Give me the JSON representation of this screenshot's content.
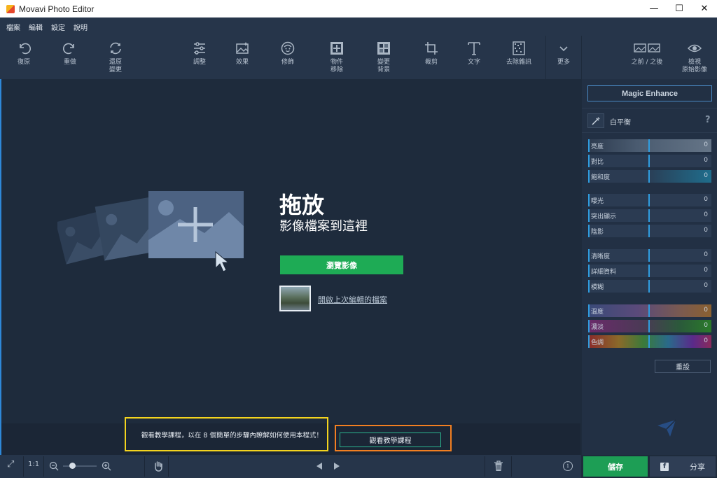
{
  "window": {
    "title": "Movavi Photo Editor",
    "minimize": "—",
    "maximize": "☐",
    "close": "✕"
  },
  "menu": [
    "檔案",
    "編輯",
    "設定",
    "說明"
  ],
  "toolbar": {
    "undo": "復原",
    "redo": "重做",
    "restore": "還原\n變更",
    "adjust": "調整",
    "effects": "效果",
    "retouch": "修飾",
    "object_removal": "物件\n移除",
    "change_bg": "變更\n背景",
    "crop": "裁剪",
    "text": "文字",
    "denoise": "去除雜訊",
    "more": "更多",
    "before_after": "之前 / 之後",
    "view_original": "檢視\n原始影像"
  },
  "canvas": {
    "drop_title": "拖放",
    "drop_subtitle": "影像檔案到這裡",
    "browse_button": "瀏覽影像",
    "recent_link": "開啟上次編輯的檔案",
    "tutorial_text": "觀看教學課程，以在 8 個簡單的步驟內瞭解如何使用本程式！",
    "tutorial_button": "觀看教學課程"
  },
  "statusbar": {
    "fit": "⤢",
    "actual_size": "1:1",
    "zoom_level": 0.3,
    "info": "i"
  },
  "panel": {
    "magic_enhance": "Magic Enhance",
    "white_balance": "白平衡",
    "help": "?",
    "sliders": [
      {
        "label": "亮度",
        "value": "0",
        "bar_value": 0
      },
      {
        "label": "對比",
        "value": "0",
        "bar_value": 0
      },
      {
        "label": "飽和度",
        "value": "0",
        "bar_value": 0
      },
      {
        "label": "曝光",
        "value": "0",
        "bar_value": 0
      },
      {
        "label": "突出顯示",
        "value": "0",
        "bar_value": 0
      },
      {
        "label": "陰影",
        "value": "0",
        "bar_value": 0
      },
      {
        "label": "清晰度",
        "value": "0",
        "bar_value": 0
      },
      {
        "label": "詳細資料",
        "value": "0",
        "bar_value": 0
      },
      {
        "label": "模糊",
        "value": "0",
        "bar_value": 0
      },
      {
        "label": "溫度",
        "value": "0",
        "bar_value": 0
      },
      {
        "label": "濃淡",
        "value": "0",
        "bar_value": 0
      },
      {
        "label": "色調",
        "value": "0",
        "bar_value": 0
      }
    ],
    "reset": "重設",
    "save": "儲存",
    "share": "分享"
  },
  "colors": {
    "accent": "#1eab55",
    "highlight_yellow": "#f4d41e",
    "highlight_orange": "#f27f21",
    "slider_marker": "#2f9de0"
  }
}
